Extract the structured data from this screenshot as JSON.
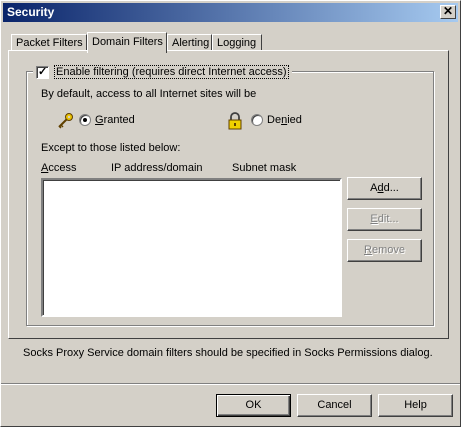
{
  "window": {
    "title": "Security",
    "close_glyph": "✕"
  },
  "tabs": [
    {
      "label": "Packet Filters",
      "active": false
    },
    {
      "label": "Domain Filters",
      "active": true
    },
    {
      "label": "Alerting",
      "active": false
    },
    {
      "label": "Logging",
      "active": false
    }
  ],
  "domain_filters": {
    "enable_checkbox": {
      "label": "Enable filtering  (requires direct Internet access)",
      "checked": true
    },
    "default_access_text": "By default, access to all Internet sites will be",
    "granted": {
      "label": "Granted",
      "selected": true,
      "icon": "key-icon"
    },
    "denied": {
      "label": "Denied",
      "selected": false,
      "icon": "lock-icon"
    },
    "except_text": "Except to those listed below:",
    "columns": [
      "Access",
      "IP address/domain",
      "Subnet mask"
    ],
    "rows": [],
    "buttons": {
      "add": {
        "prefix": "A",
        "ul": "d",
        "suffix": "d...",
        "enabled": true
      },
      "edit": {
        "prefix": "",
        "ul": "E",
        "suffix": "dit...",
        "enabled": false
      },
      "remove": {
        "prefix": "",
        "ul": "R",
        "suffix": "emove",
        "enabled": false
      }
    }
  },
  "footer_note": "Socks Proxy Service domain filters should be specified in Socks Permissions dialog.",
  "dialog_buttons": {
    "ok": "OK",
    "cancel": "Cancel",
    "help": "Help"
  },
  "colors": {
    "title_start": "#0a246a",
    "title_end": "#a6caf0",
    "face": "#d4d0c8",
    "key": "#c8a000",
    "lock": "#e0c000"
  }
}
